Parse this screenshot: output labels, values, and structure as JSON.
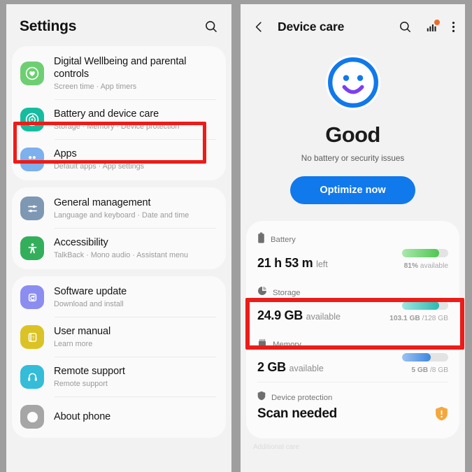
{
  "left_panel": {
    "header": {
      "title": "Settings",
      "search_icon": "search-icon"
    },
    "groups": [
      {
        "items": [
          {
            "title": "Digital Wellbeing and parental controls",
            "subtitle": "Screen time  ·  App timers",
            "icon": "wellbeing-heart-icon",
            "icon_color": "#6dcf72",
            "highlighted": false
          },
          {
            "title": "Battery and device care",
            "subtitle": "Storage  ·  Memory  ·  Device protection",
            "icon": "battery-care-icon",
            "icon_color": "#16bca0",
            "highlighted": true
          },
          {
            "title": "Apps",
            "subtitle": "Default apps  ·  App settings",
            "icon": "apps-grid-icon",
            "icon_color": "#7cb0ee",
            "highlighted": false
          }
        ]
      },
      {
        "items": [
          {
            "title": "General management",
            "subtitle": "Language and keyboard  ·  Date and time",
            "icon": "sliders-icon",
            "icon_color": "#7e98b4",
            "highlighted": false
          },
          {
            "title": "Accessibility",
            "subtitle": "TalkBack  ·  Mono audio  ·  Assistant menu",
            "icon": "accessibility-person-icon",
            "icon_color": "#33af5c",
            "highlighted": false
          }
        ]
      },
      {
        "items": [
          {
            "title": "Software update",
            "subtitle": "Download and install",
            "icon": "software-update-icon",
            "icon_color": "#8b8df0",
            "highlighted": false
          },
          {
            "title": "User manual",
            "subtitle": "Learn more",
            "icon": "manual-book-icon",
            "icon_color": "#dbc326",
            "highlighted": false
          },
          {
            "title": "Remote support",
            "subtitle": "Remote support",
            "icon": "headset-icon",
            "icon_color": "#34bcd9",
            "highlighted": false
          },
          {
            "title": "About phone",
            "subtitle": "",
            "icon": "info-icon",
            "icon_color": "#a6a6a6",
            "highlighted": false
          }
        ]
      }
    ]
  },
  "right_panel": {
    "header": {
      "back_icon": "back-chevron-icon",
      "title": "Device care",
      "search_icon": "search-icon",
      "stats_icon": "bar-chart-icon",
      "stats_badge_color": "#f06a26",
      "menu_icon": "overflow-menu-icon"
    },
    "hero": {
      "face_icon": "smiley-face-icon",
      "face_ring_color": "#1079ec",
      "smile_color": "#7b3ff2",
      "status": "Good",
      "status_sub": "No battery or security issues",
      "optimize_label": "Optimize now",
      "optimize_color": "#1079ec"
    },
    "metrics": [
      {
        "id": "battery",
        "icon": "battery-icon",
        "label": "Battery",
        "value": "21 h 53 m",
        "value_suffix": "left",
        "note_bold": "81%",
        "note_weak": " available",
        "bar_percent": 81,
        "bar_from": "#a9e9ab",
        "bar_to": "#4fc552",
        "highlighted": false
      },
      {
        "id": "storage",
        "icon": "storage-pie-icon",
        "label": "Storage",
        "value": "24.9 GB",
        "value_suffix": "available",
        "note_bold": "103.1 GB",
        "note_weak": " /128 GB",
        "bar_percent": 81,
        "bar_from": "#9fe6e0",
        "bar_to": "#2bb9b0",
        "highlighted": true
      },
      {
        "id": "memory",
        "icon": "memory-chip-icon",
        "label": "Memory",
        "value": "2 GB",
        "value_suffix": "available",
        "note_bold": "5 GB",
        "note_weak": " /8 GB",
        "bar_percent": 62,
        "bar_from": "#9cc3f2",
        "bar_to": "#3e86e0",
        "highlighted": false
      }
    ],
    "protection": {
      "icon": "shield-icon",
      "label": "Device protection",
      "value": "Scan needed",
      "badge_icon": "warning-shield-icon",
      "badge_color": "#f4a83c"
    },
    "footer_hint": "Additional care"
  }
}
